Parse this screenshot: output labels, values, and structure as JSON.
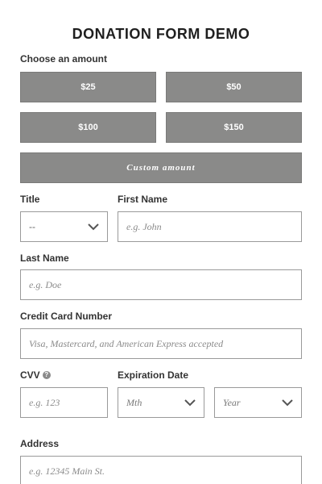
{
  "page": {
    "title": "DONATION FORM DEMO"
  },
  "amount": {
    "label": "Choose an amount",
    "options": [
      "$25",
      "$50",
      "$100",
      "$150"
    ],
    "custom_label": "Custom amount"
  },
  "form": {
    "title": {
      "label": "Title",
      "value": "--"
    },
    "first_name": {
      "label": "First Name",
      "placeholder": "e.g. John"
    },
    "last_name": {
      "label": "Last Name",
      "placeholder": "e.g. Doe"
    },
    "card_number": {
      "label": "Credit Card Number",
      "placeholder": "Visa, Mastercard, and American Express accepted"
    },
    "cvv": {
      "label": "CVV",
      "placeholder": "e.g. 123",
      "help_icon": "question-circle-icon"
    },
    "expiration": {
      "label": "Expiration Date",
      "month_value": "Mth",
      "year_value": "Year"
    },
    "address": {
      "label": "Address",
      "placeholder": "e.g. 12345 Main St."
    }
  },
  "colors": {
    "button_bg": "#8a8a89",
    "border": "#9a9a9a",
    "text": "#2b2b2b"
  }
}
